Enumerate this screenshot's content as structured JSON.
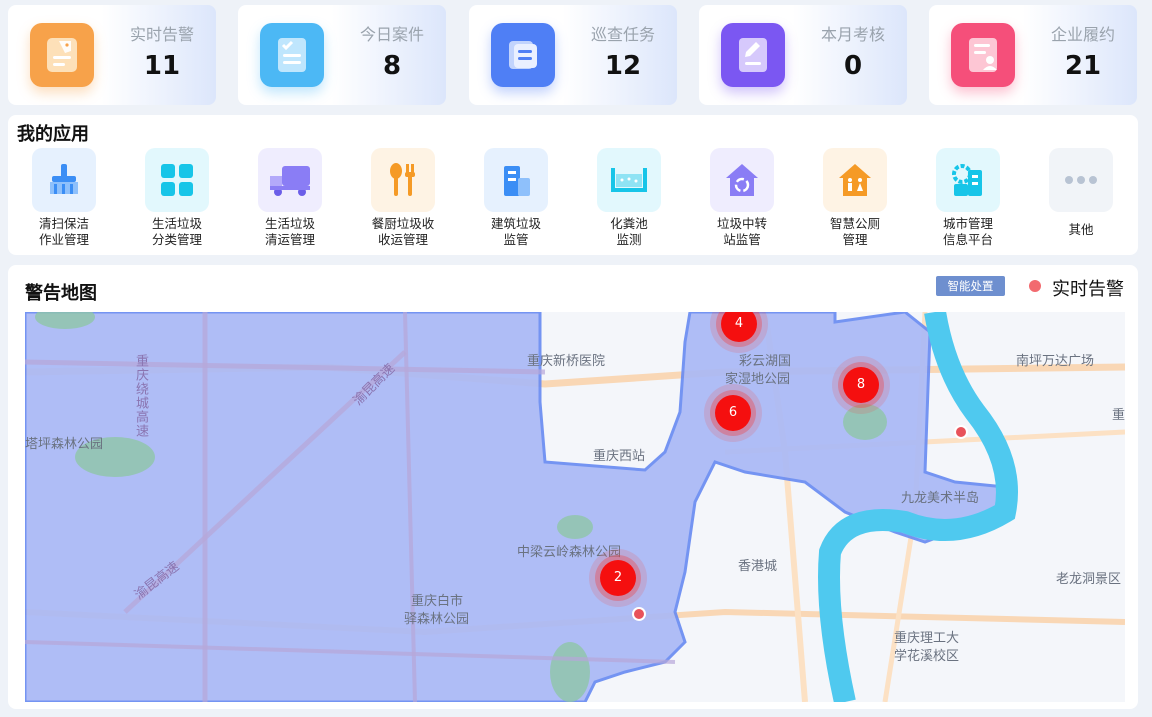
{
  "stats": [
    {
      "label": "实时告警",
      "value": "11",
      "icon": "tag-list-icon",
      "color": "#f7a24a"
    },
    {
      "label": "今日案件",
      "value": "8",
      "icon": "checklist-icon",
      "color": "#4cb8f5"
    },
    {
      "label": "巡查任务",
      "value": "12",
      "icon": "documents-icon",
      "color": "#4f7ff5"
    },
    {
      "label": "本月考核",
      "value": "0",
      "icon": "edit-document-icon",
      "color": "#7b57f2"
    },
    {
      "label": "企业履约",
      "value": "21",
      "icon": "contract-person-icon",
      "color": "#f54f7a"
    }
  ],
  "apps": {
    "title": "我的应用",
    "items": [
      {
        "label": "清扫保洁\n作业管理",
        "icon": "broom-icon",
        "color": "#3b8ef5"
      },
      {
        "label": "生活垃圾\n分类管理",
        "icon": "grid-icon",
        "color": "#17c5e8"
      },
      {
        "label": "生活垃圾\n清运管理",
        "icon": "truck-icon",
        "color": "#8a7df5"
      },
      {
        "label": "餐厨垃圾收\n收运管理",
        "icon": "fork-spoon-icon",
        "color": "#f59a26"
      },
      {
        "label": "建筑垃圾\n监管",
        "icon": "building-icon",
        "color": "#3b8ef5"
      },
      {
        "label": "化粪池\n监测",
        "icon": "tank-icon",
        "color": "#17c5e8"
      },
      {
        "label": "垃圾中转\n站监管",
        "icon": "recycle-house-icon",
        "color": "#8a7df5"
      },
      {
        "label": "智慧公厕\n管理",
        "icon": "toilet-icon",
        "color": "#f59a26"
      },
      {
        "label": "城市管理\n信息平台",
        "icon": "gear-building-icon",
        "color": "#17c5e8"
      },
      {
        "label": "其他",
        "icon": "more-icon",
        "color": "#b8c3d3"
      }
    ]
  },
  "map": {
    "title": "警告地图",
    "smart_button": "智能处置",
    "legend": "实时告警",
    "places": [
      "重庆新桥医院",
      "彩云湖国",
      "家湿地公园",
      "南坪万达广场",
      "重庆西站",
      "九龙美术半岛",
      "中梁云岭森林公园",
      "香港城",
      "重庆白市",
      "驿森林公园",
      "重庆理工大",
      "学花溪校区",
      "老龙洞景区",
      "塔坪森林公园",
      "重",
      "重庆绕城高速",
      "渝昆高速",
      "渝昆高速"
    ],
    "clusters": [
      "4",
      "6",
      "8",
      "2"
    ]
  }
}
